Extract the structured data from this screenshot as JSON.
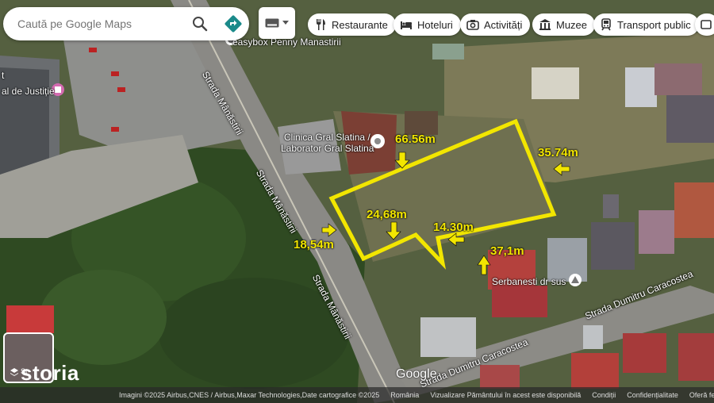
{
  "search": {
    "placeholder": "Caută pe Google Maps"
  },
  "chips": [
    {
      "label": "Restaurante",
      "icon": "fork-knife-icon"
    },
    {
      "label": "Hoteluri",
      "icon": "bed-icon"
    },
    {
      "label": "Activități",
      "icon": "camera-icon"
    },
    {
      "label": "Muzee",
      "icon": "museum-icon"
    },
    {
      "label": "Transport public",
      "icon": "train-icon"
    }
  ],
  "places": {
    "easybox": "easybox Penny Manastirii",
    "justitie": "al de Justiție",
    "justitie_pre": "t",
    "clinica_1": "Clinica Gral Slatina /",
    "clinica_2": "Laborator Gral Slatina",
    "serbanesti": "Serbanesti dr sus"
  },
  "roads": {
    "manastirii_1": "Strada Mânăstirii",
    "manastirii_2": "Strada Mânăstirii",
    "manastirii_3": "Strada Mânăstirii",
    "caracostea_1": "Strada Dumitru Caracostea",
    "caracostea_2": "Strada Dumitru Caracostea"
  },
  "measurements": {
    "top": "66.56m",
    "right": "35.74m",
    "left": "18,54m",
    "inner": "24,68m",
    "notch": "14.30m",
    "bottom": "37,1m"
  },
  "brand": "storia",
  "brand_partial": "St",
  "google": "Google",
  "footer": [
    "Imagini ©2025 Airbus,CNES / Airbus,Maxar Technologies,Date cartografice ©2025",
    "România",
    "Vizualizare Pământului în acest este disponibilă",
    "Condiții",
    "Confidențialitate",
    "Oferă feedback pr"
  ],
  "colors": {
    "boundary": "#f2e600",
    "pin_red": "#d8534a"
  }
}
